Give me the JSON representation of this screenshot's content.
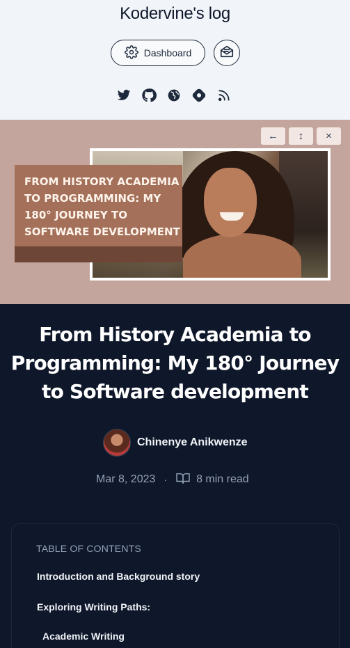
{
  "header": {
    "blog_title": "Kodervine's log",
    "dashboard_label": "Dashboard",
    "icons": [
      "gear-icon",
      "newsletter-icon",
      "twitter-icon",
      "github-icon",
      "globe-icon",
      "hashnode-icon",
      "rss-icon"
    ]
  },
  "cover": {
    "banner_text": "FROM HISTORY ACADEMIA TO PROGRAMMING: MY 180° JOURNEY TO SOFTWARE DEVELOPMENT",
    "controls": [
      "←",
      "↕",
      "×"
    ],
    "background_color": "#c4a59d"
  },
  "post": {
    "title": "From History Academia to Programming: My 180° Journey to Software development",
    "author": "Chinenye Anikwenze",
    "date": "Mar 8, 2023",
    "separator": "·",
    "read_time": "8 min read"
  },
  "toc": {
    "title": "TABLE OF CONTENTS",
    "items": [
      "Introduction and Background story",
      "Exploring Writing Paths:",
      "Academic Writing"
    ]
  },
  "colors": {
    "page_bg": "#0f172a",
    "header_bg": "#f1f5f9"
  }
}
